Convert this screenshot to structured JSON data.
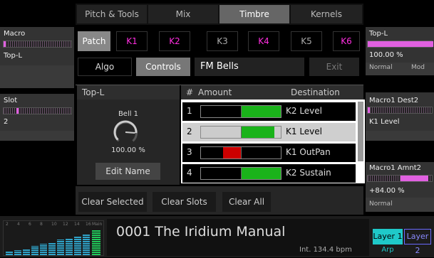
{
  "tabs": [
    "Pitch & Tools",
    "Mix",
    "Timbre",
    "Kernels"
  ],
  "left": {
    "macro_label": "Macro",
    "macro_value": "Top-L",
    "slot_label": "Slot",
    "slot_value": "2"
  },
  "right": {
    "top_label": "Top-L",
    "top_value": "100.00 %",
    "top_mode_a": "Normal",
    "top_mode_b": "Mod",
    "dest_label": "Macro1 Dest2",
    "dest_value": "K1 Level",
    "amnt_label": "Macro1 Amnt2",
    "amnt_value": "+84.00 %",
    "amnt_mode": "Normal"
  },
  "patch_label": "Patch",
  "kernels": [
    {
      "label": "K1",
      "active": true
    },
    {
      "label": "K2",
      "active": true
    },
    {
      "label": "K3",
      "active": false
    },
    {
      "label": "K4",
      "active": true
    },
    {
      "label": "K5",
      "active": false
    },
    {
      "label": "K6",
      "active": true
    }
  ],
  "algo_label": "Algo",
  "controls_label": "Controls",
  "preset_name": "FM Bells",
  "exit_label": "Exit",
  "macro_panel": {
    "title": "Top-L",
    "knob_name": "Bell 1",
    "knob_value": "100.00 %",
    "knob_fraction": 0.85,
    "edit_label": "Edit Name"
  },
  "table": {
    "col_num": "#",
    "col_amount": "Amount",
    "col_dest": "Destination",
    "rows": [
      {
        "num": "1",
        "amount": 1.0,
        "dest": "K2 Level",
        "selected": false
      },
      {
        "num": "2",
        "amount": 0.84,
        "dest": "K1 Level",
        "selected": true
      },
      {
        "num": "3",
        "amount": -0.45,
        "dest": "K1 OutPan",
        "selected": false
      },
      {
        "num": "4",
        "amount": 1.0,
        "dest": "K2 Sustain",
        "selected": false
      }
    ]
  },
  "bottom_buttons": [
    "Clear Selected",
    "Clear Slots",
    "Clear All"
  ],
  "meter": {
    "scale": [
      "2",
      "4",
      "6",
      "8",
      "10",
      "12",
      "14",
      "16",
      "Main"
    ],
    "levels": [
      0.15,
      0.2,
      0.25,
      0.35,
      0.45,
      0.5,
      0.6,
      0.65,
      0.75,
      0.8
    ]
  },
  "patch_title": "0001 The Iridium Manual",
  "tempo": "Int. 134.4 bpm",
  "layer1_label": "Layer 1",
  "layer2_label": "Layer 2",
  "arp_label": "Arp"
}
